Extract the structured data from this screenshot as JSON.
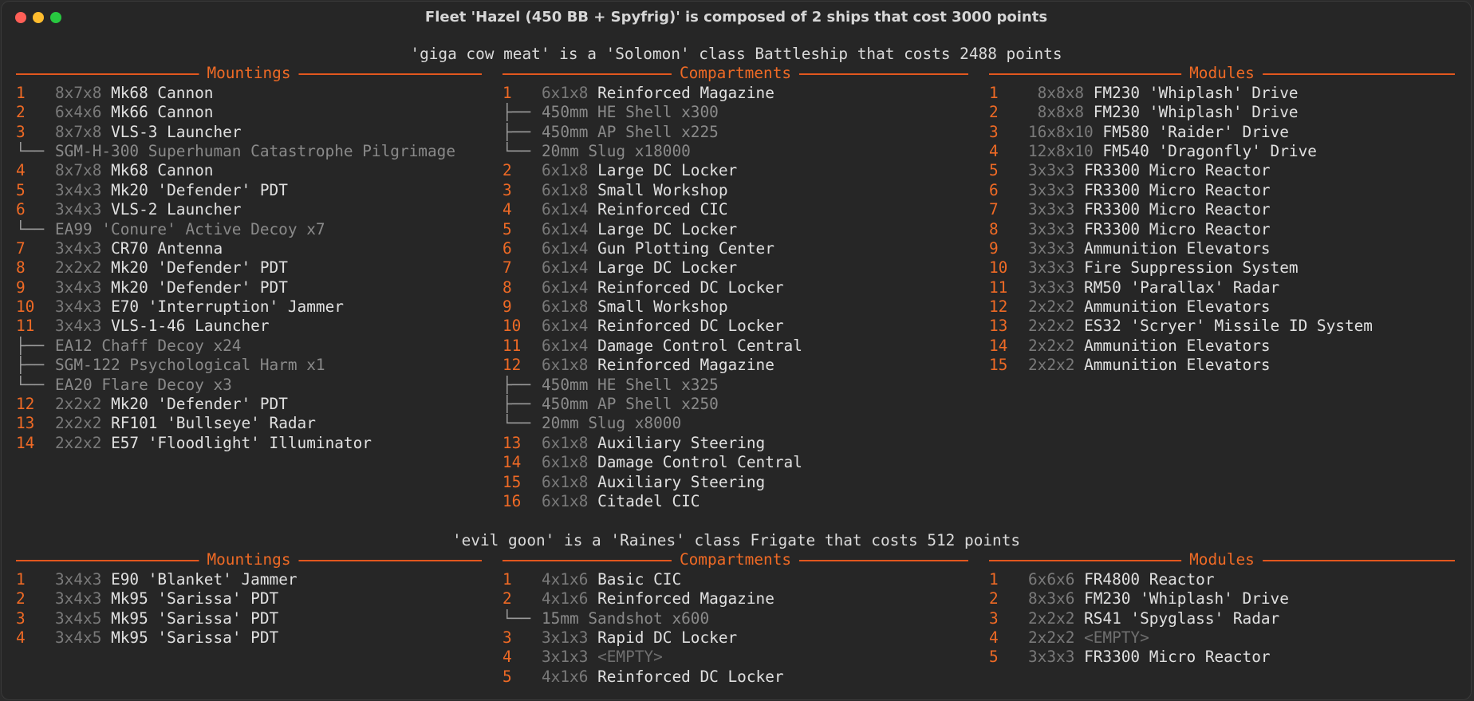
{
  "window": {
    "title": "Fleet 'Hazel (450 BB + Spyfrig)' is composed of 2 ships that cost 3000 points"
  },
  "ships": [
    {
      "title": "'giga cow meat' is a 'Solomon' class Battleship that costs 2488 points",
      "columns": [
        {
          "header": "Mountings",
          "rows": [
            {
              "n": "1",
              "size": "8x7x8",
              "name": "Mk68 Cannon"
            },
            {
              "n": "2",
              "size": "6x4x6",
              "name": "Mk66 Cannon"
            },
            {
              "n": "3",
              "size": "8x7x8",
              "name": "VLS-3 Launcher"
            },
            {
              "tree": "└──",
              "sub": "SGM-H-300 Superhuman Catastrophe Pilgrimage"
            },
            {
              "n": "4",
              "size": "8x7x8",
              "name": "Mk68 Cannon"
            },
            {
              "n": "5",
              "size": "3x4x3",
              "name": "Mk20 'Defender' PDT"
            },
            {
              "n": "6",
              "size": "3x4x3",
              "name": "VLS-2 Launcher"
            },
            {
              "tree": "└──",
              "sub": "EA99 'Conure' Active Decoy x7"
            },
            {
              "n": "7",
              "size": "3x4x3",
              "name": "CR70 Antenna"
            },
            {
              "n": "8",
              "size": "2x2x2",
              "name": "Mk20 'Defender' PDT"
            },
            {
              "n": "9",
              "size": "3x4x3",
              "name": "Mk20 'Defender' PDT"
            },
            {
              "n": "10",
              "size": "3x4x3",
              "name": "E70 'Interruption' Jammer"
            },
            {
              "n": "11",
              "size": "3x4x3",
              "name": "VLS-1-46 Launcher"
            },
            {
              "tree": "├──",
              "sub": "EA12 Chaff Decoy x24"
            },
            {
              "tree": "├──",
              "sub": "SGM-122 Psychological Harm x1"
            },
            {
              "tree": "└──",
              "sub": "EA20 Flare Decoy x3"
            },
            {
              "n": "12",
              "size": "2x2x2",
              "name": "Mk20 'Defender' PDT"
            },
            {
              "n": "13",
              "size": "2x2x2",
              "name": "RF101 'Bullseye' Radar"
            },
            {
              "n": "14",
              "size": "2x2x2",
              "name": "E57 'Floodlight' Illuminator"
            }
          ]
        },
        {
          "header": "Compartments",
          "rows": [
            {
              "n": "1",
              "size": "6x1x8",
              "name": "Reinforced Magazine"
            },
            {
              "tree": "├──",
              "sub": "450mm HE Shell x300"
            },
            {
              "tree": "├──",
              "sub": "450mm AP Shell x225"
            },
            {
              "tree": "└──",
              "sub": "20mm Slug x18000"
            },
            {
              "n": "2",
              "size": "6x1x8",
              "name": "Large DC Locker"
            },
            {
              "n": "3",
              "size": "6x1x8",
              "name": "Small Workshop"
            },
            {
              "n": "4",
              "size": "6x1x4",
              "name": "Reinforced CIC"
            },
            {
              "n": "5",
              "size": "6x1x4",
              "name": "Large DC Locker"
            },
            {
              "n": "6",
              "size": "6x1x4",
              "name": "Gun Plotting Center"
            },
            {
              "n": "7",
              "size": "6x1x4",
              "name": "Large DC Locker"
            },
            {
              "n": "8",
              "size": "6x1x4",
              "name": "Reinforced DC Locker"
            },
            {
              "n": "9",
              "size": "6x1x8",
              "name": "Small Workshop"
            },
            {
              "n": "10",
              "size": "6x1x4",
              "name": "Reinforced DC Locker"
            },
            {
              "n": "11",
              "size": "6x1x4",
              "name": "Damage Control Central"
            },
            {
              "n": "12",
              "size": "6x1x8",
              "name": "Reinforced Magazine"
            },
            {
              "tree": "├──",
              "sub": "450mm HE Shell x325"
            },
            {
              "tree": "├──",
              "sub": "450mm AP Shell x250"
            },
            {
              "tree": "└──",
              "sub": "20mm Slug x8000"
            },
            {
              "n": "13",
              "size": "6x1x8",
              "name": "Auxiliary Steering"
            },
            {
              "n": "14",
              "size": "6x1x8",
              "name": "Damage Control Central"
            },
            {
              "n": "15",
              "size": "6x1x8",
              "name": "Auxiliary Steering"
            },
            {
              "n": "16",
              "size": "6x1x8",
              "name": "Citadel CIC"
            }
          ]
        },
        {
          "header": "Modules",
          "rows": [
            {
              "n": "1",
              "size": " 8x8x8",
              "name": "FM230 'Whiplash' Drive"
            },
            {
              "n": "2",
              "size": " 8x8x8",
              "name": "FM230 'Whiplash' Drive"
            },
            {
              "n": "3",
              "size": "16x8x10",
              "name": "FM580 'Raider' Drive"
            },
            {
              "n": "4",
              "size": "12x8x10",
              "name": "FM540 'Dragonfly' Drive"
            },
            {
              "n": "5",
              "size": "3x3x3",
              "name": "FR3300 Micro Reactor"
            },
            {
              "n": "6",
              "size": "3x3x3",
              "name": "FR3300 Micro Reactor"
            },
            {
              "n": "7",
              "size": "3x3x3",
              "name": "FR3300 Micro Reactor"
            },
            {
              "n": "8",
              "size": "3x3x3",
              "name": "FR3300 Micro Reactor"
            },
            {
              "n": "9",
              "size": "3x3x3",
              "name": "Ammunition Elevators"
            },
            {
              "n": "10",
              "size": "3x3x3",
              "name": "Fire Suppression System"
            },
            {
              "n": "11",
              "size": "3x3x3",
              "name": "RM50 'Parallax' Radar"
            },
            {
              "n": "12",
              "size": "2x2x2",
              "name": "Ammunition Elevators"
            },
            {
              "n": "13",
              "size": "2x2x2",
              "name": "ES32 'Scryer' Missile ID System"
            },
            {
              "n": "14",
              "size": "2x2x2",
              "name": "Ammunition Elevators"
            },
            {
              "n": "15",
              "size": "2x2x2",
              "name": "Ammunition Elevators"
            }
          ]
        }
      ]
    },
    {
      "title": "'evil goon' is a 'Raines' class Frigate that costs 512 points",
      "columns": [
        {
          "header": "Mountings",
          "rows": [
            {
              "n": "1",
              "size": "3x4x3",
              "name": "E90 'Blanket' Jammer"
            },
            {
              "n": "2",
              "size": "3x4x3",
              "name": "Mk95 'Sarissa' PDT"
            },
            {
              "n": "3",
              "size": "3x4x5",
              "name": "Mk95 'Sarissa' PDT"
            },
            {
              "n": "4",
              "size": "3x4x5",
              "name": "Mk95 'Sarissa' PDT"
            }
          ]
        },
        {
          "header": "Compartments",
          "rows": [
            {
              "n": "1",
              "size": "4x1x6",
              "name": "Basic CIC"
            },
            {
              "n": "2",
              "size": "4x1x6",
              "name": "Reinforced Magazine"
            },
            {
              "tree": "└──",
              "sub": "15mm Sandshot x600"
            },
            {
              "n": "3",
              "size": "3x1x3",
              "name": "Rapid DC Locker"
            },
            {
              "n": "4",
              "size": "3x1x3",
              "empty": "<EMPTY>"
            },
            {
              "n": "5",
              "size": "4x1x6",
              "name": "Reinforced DC Locker"
            }
          ]
        },
        {
          "header": "Modules",
          "rows": [
            {
              "n": "1",
              "size": "6x6x6",
              "name": "FR4800 Reactor"
            },
            {
              "n": "2",
              "size": "8x3x6",
              "name": "FM230 'Whiplash' Drive"
            },
            {
              "n": "3",
              "size": "2x2x2",
              "name": "RS41 'Spyglass' Radar"
            },
            {
              "n": "4",
              "size": "2x2x2",
              "empty": "<EMPTY>"
            },
            {
              "n": "5",
              "size": "3x3x3",
              "name": "FR3300 Micro Reactor"
            }
          ]
        }
      ]
    }
  ]
}
